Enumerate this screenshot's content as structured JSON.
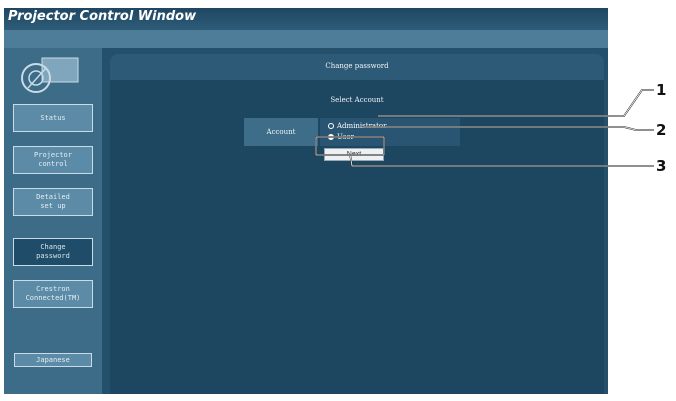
{
  "window": {
    "title": "Projector Control Window"
  },
  "sidebar": {
    "items": [
      {
        "label": "Status",
        "active": false
      },
      {
        "label": "Projector\ncontrol",
        "active": false
      },
      {
        "label": "Detailed\nset up",
        "active": false
      },
      {
        "label": "Change\npassword",
        "active": true
      },
      {
        "label": "Crestron\nConnected(TM)",
        "active": false
      }
    ],
    "language_button": "Japanese"
  },
  "main": {
    "panel_title": "Change password",
    "section_title": "Select Account",
    "account": {
      "label": "Account",
      "options": [
        {
          "label": "Administrator",
          "checked": false
        },
        {
          "label": "User",
          "checked": true
        }
      ]
    },
    "next_button": "Next"
  },
  "callouts": [
    "1",
    "2",
    "3"
  ],
  "colors": {
    "window_bg": "#2a5470",
    "sidebar_bg": "#3c6c88",
    "panel_bg": "#1d4661",
    "button_bg": "#5b8ba6"
  }
}
